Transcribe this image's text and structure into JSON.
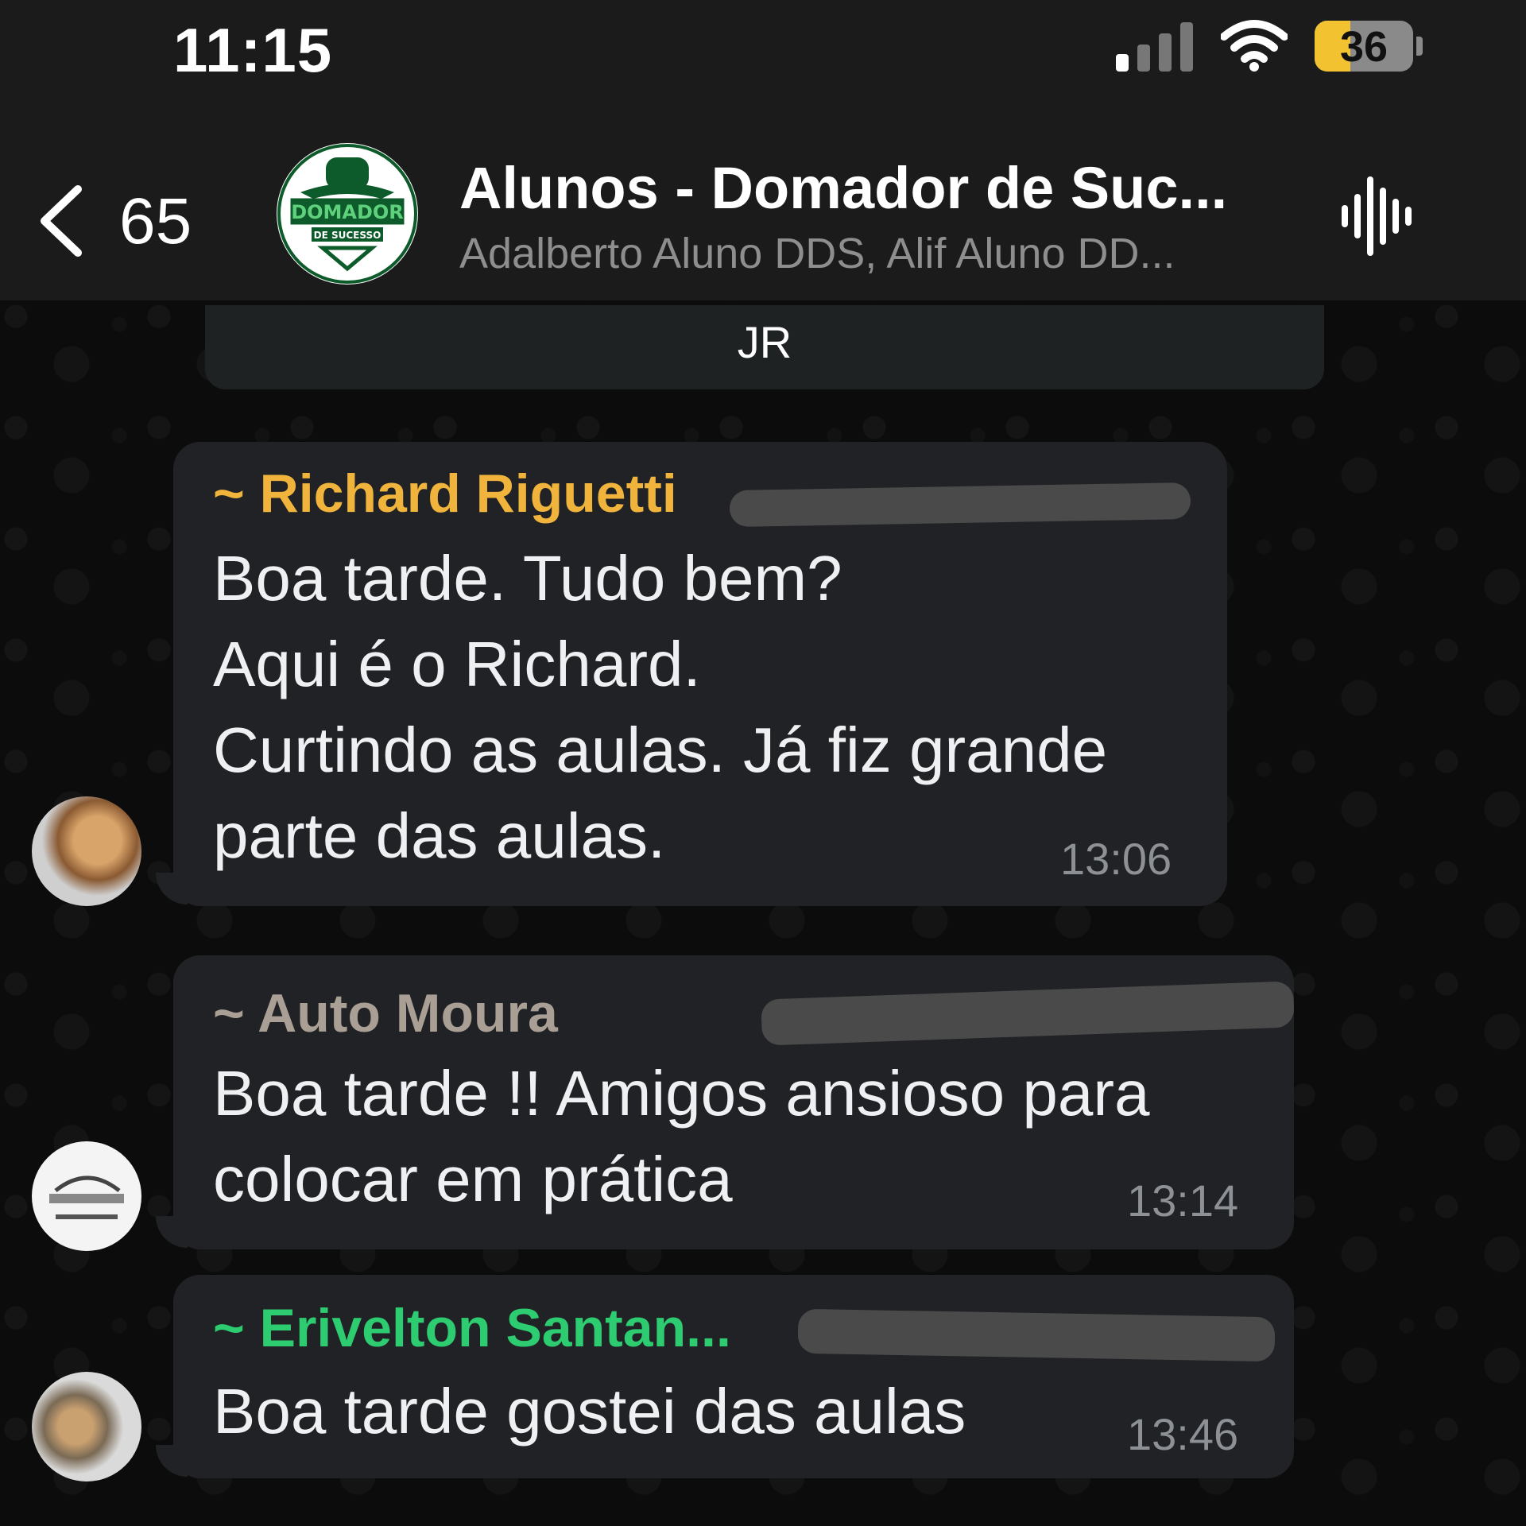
{
  "status_bar": {
    "time": "11:15",
    "battery_level": "36",
    "battery_color": "#f2c230",
    "signal_bars_active": 1,
    "signal_bars_total": 4
  },
  "header": {
    "back_count": "65",
    "title": "Alunos - Domador de Suc...",
    "members": "Adalberto Aluno DDS, Alif Aluno DD...",
    "avatar_icon": "group-logo-icon",
    "call_icon": "waveform-icon",
    "logo_text_line1": "DOMADOR",
    "logo_text_line2": "DE SUCESSO"
  },
  "date_chip": "JR",
  "messages": [
    {
      "sender": "~ Richard Riguetti",
      "sender_color": "#f0b43c",
      "lines": [
        "Boa tarde. Tudo bem?",
        "Aqui é o Richard.",
        "Curtindo as aulas. Já fiz grande",
        "parte das aulas."
      ],
      "time": "13:06"
    },
    {
      "sender": "~ Auto Moura",
      "sender_color": "#a99f94",
      "lines": [
        "Boa tarde !! Amigos ansioso  para",
        "colocar  em prática"
      ],
      "time": "13:14"
    },
    {
      "sender": "~ Erivelton Santan...",
      "sender_color": "#2ecc71",
      "lines": [
        "Boa tarde gostei das aulas"
      ],
      "time": "13:46"
    }
  ]
}
